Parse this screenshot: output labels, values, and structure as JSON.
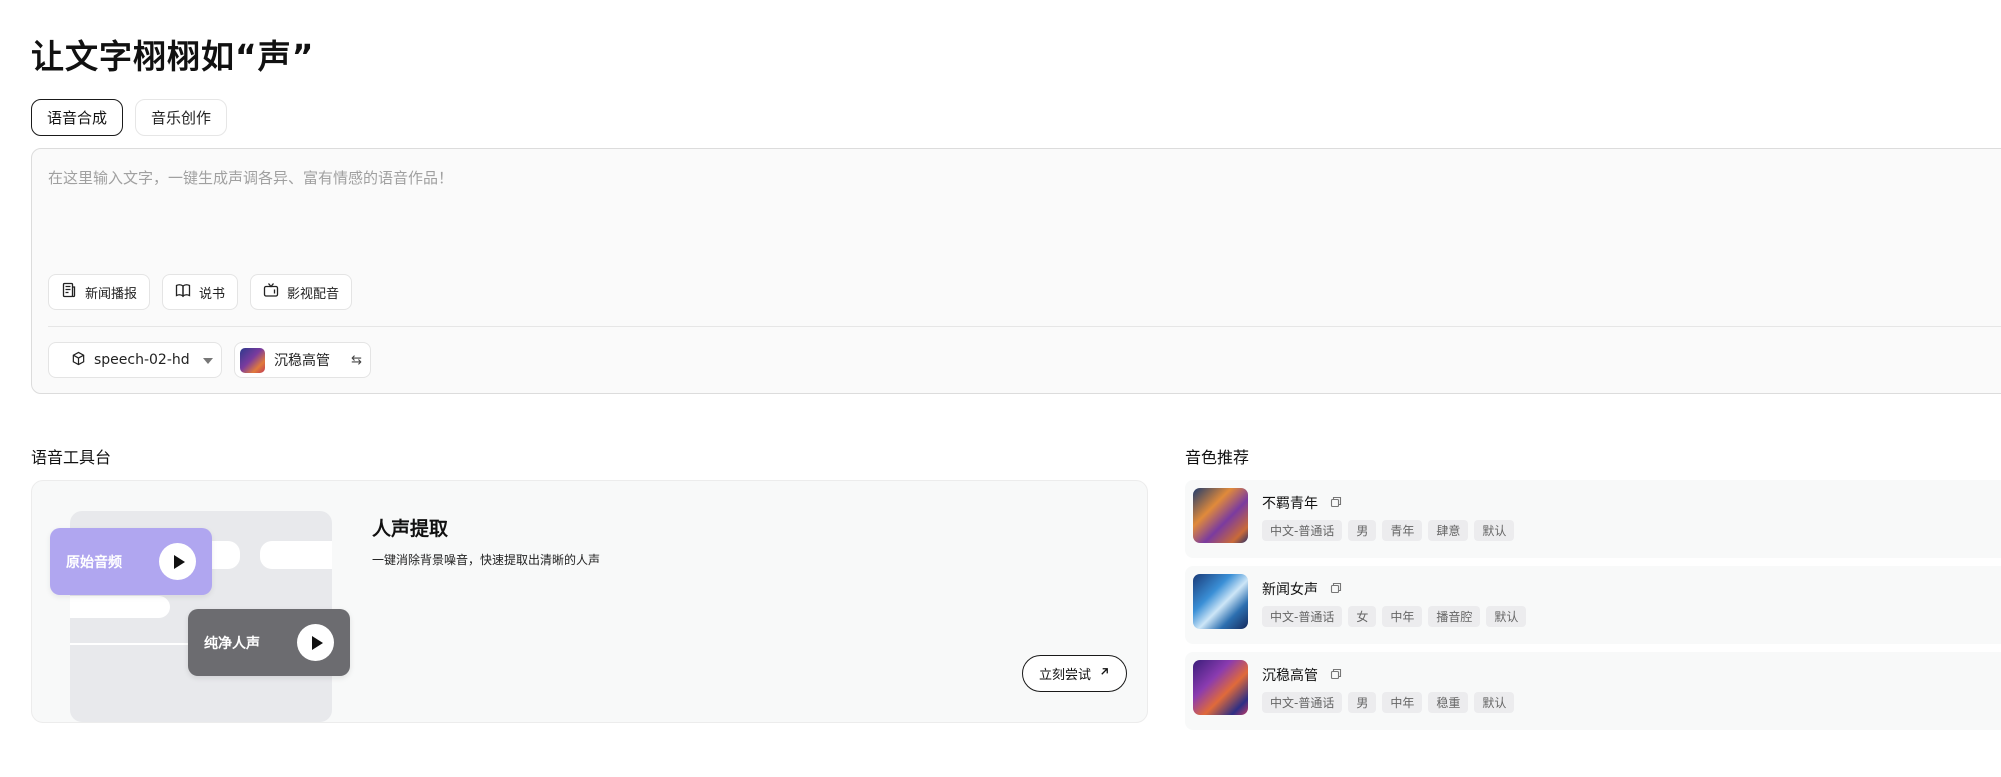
{
  "page": {
    "title": "让文字栩栩如“声”"
  },
  "tabs": [
    {
      "label": "语音合成",
      "active": true
    },
    {
      "label": "音乐创作",
      "active": false
    }
  ],
  "editor": {
    "placeholder": "在这里输入文字，一键生成声调各异、富有情感的语音作品！",
    "value": "",
    "chips": [
      {
        "label": "新闻播报",
        "icon": "newspaper-icon"
      },
      {
        "label": "说书",
        "icon": "book-open-icon"
      },
      {
        "label": "影视配音",
        "icon": "tv-icon"
      }
    ],
    "model": {
      "value": "speech-02-hd",
      "icon": "cube-icon"
    },
    "voice": {
      "value": "沉稳高管",
      "icon": "swap-icon"
    }
  },
  "workbench": {
    "section_title": "语音工具台",
    "tool": {
      "title": "人声提取",
      "desc": "一键消除背景噪音，快速提取出清晰的人声",
      "orig_label": "原始音频",
      "pure_label": "纯净人声",
      "try_label": "立刻尝试",
      "orig_color": "#b0a6f0",
      "pure_color": "#6c6c70"
    }
  },
  "voices": {
    "section_title": "音色推荐",
    "items": [
      {
        "name": "不羁青年",
        "tags": [
          "中文-普通话",
          "男",
          "青年",
          "肆意",
          "默认"
        ]
      },
      {
        "name": "新闻女声",
        "tags": [
          "中文-普通话",
          "女",
          "中年",
          "播音腔",
          "默认"
        ]
      },
      {
        "name": "沉稳高管",
        "tags": [
          "中文-普通话",
          "男",
          "中年",
          "稳重",
          "默认"
        ]
      }
    ]
  }
}
